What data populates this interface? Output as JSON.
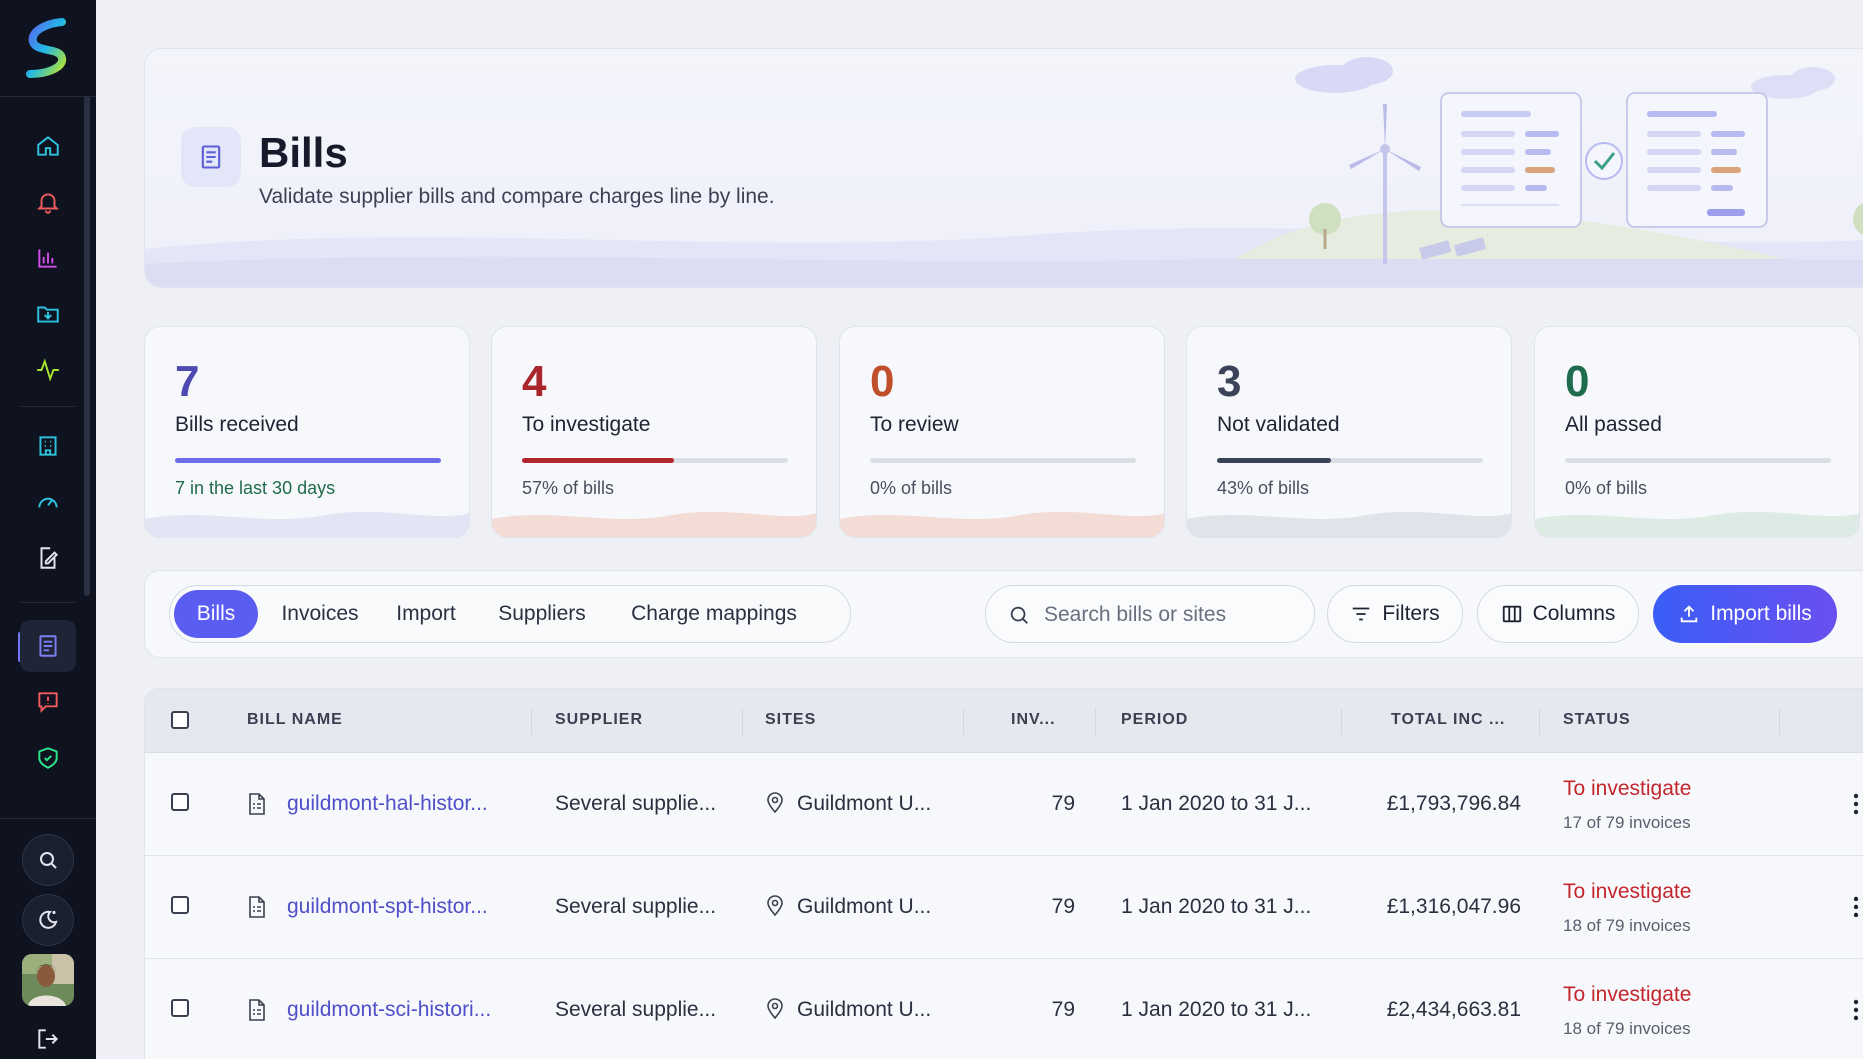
{
  "sidebar": {
    "nav": [
      "home-icon",
      "bell-icon",
      "bar-chart-icon",
      "download-icon",
      "activity-icon",
      "building-icon",
      "gauge-icon",
      "edit-doc-icon",
      "bills-icon",
      "alert-icon",
      "shield-icon"
    ],
    "active": "bills-icon",
    "bottom": [
      "search-icon",
      "theme-icon",
      "avatar",
      "logout-icon"
    ]
  },
  "header": {
    "title": "Bills",
    "subtitle": "Validate supplier bills and compare charges line by line."
  },
  "stats": [
    {
      "value": "7",
      "label": "Bills received",
      "note": "7 in the last 30 days",
      "progress": 1.0,
      "color": "#4e4bb0",
      "bar": "#6b6ee8",
      "note_color": "#1f6b4a"
    },
    {
      "value": "4",
      "label": "To investigate",
      "note": "57% of bills",
      "progress": 0.57,
      "color": "#a8262c",
      "bar": "#b1262c",
      "note_color": "#4a4f60"
    },
    {
      "value": "0",
      "label": "To review",
      "note": "0% of bills",
      "progress": 0,
      "color": "#c0502b",
      "bar": "#c0502b",
      "note_color": "#4a4f60"
    },
    {
      "value": "3",
      "label": "Not validated",
      "note": "43% of bills",
      "progress": 0.43,
      "color": "#3a4358",
      "bar": "#3a4358",
      "note_color": "#4a4f60"
    },
    {
      "value": "0",
      "label": "All passed",
      "note": "0% of bills",
      "progress": 0,
      "color": "#1e6b4d",
      "bar": "#1e6b4d",
      "note_color": "#4a4f60"
    }
  ],
  "tabs": [
    "Bills",
    "Invoices",
    "Import",
    "Suppliers",
    "Charge mappings"
  ],
  "active_tab": "Bills",
  "search": {
    "placeholder": "Search bills or sites",
    "value": ""
  },
  "buttons": {
    "filters": "Filters",
    "columns": "Columns",
    "import": "Import bills"
  },
  "table": {
    "columns": [
      "BILL NAME",
      "SUPPLIER",
      "SITES",
      "INV...",
      "PERIOD",
      "TOTAL INC ...",
      "STATUS"
    ],
    "rows": [
      {
        "name": "guildmont-hal-histor...",
        "supplier": "Several supplie...",
        "site": "Guildmont U...",
        "invoices": "79",
        "period": "1 Jan 2020 to 31 J...",
        "total": "£1,793,796.84",
        "status": "To investigate",
        "status_detail": "17 of 79 invoices"
      },
      {
        "name": "guildmont-spt-histor...",
        "supplier": "Several supplie...",
        "site": "Guildmont U...",
        "invoices": "79",
        "period": "1 Jan 2020 to 31 J...",
        "total": "£1,316,047.96",
        "status": "To investigate",
        "status_detail": "18 of 79 invoices"
      },
      {
        "name": "guildmont-sci-histori...",
        "supplier": "Several supplie...",
        "site": "Guildmont U...",
        "invoices": "79",
        "period": "1 Jan 2020 to 31 J...",
        "total": "£2,434,663.81",
        "status": "To investigate",
        "status_detail": "18 of 79 invoices"
      }
    ]
  }
}
